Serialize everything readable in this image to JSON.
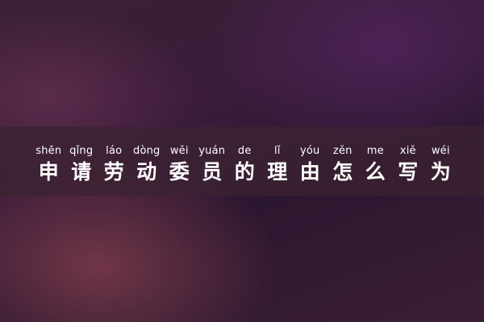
{
  "title": {
    "units": [
      {
        "pinyin": "shēn",
        "hanzi": "申"
      },
      {
        "pinyin": "qǐng",
        "hanzi": "请"
      },
      {
        "pinyin": "láo",
        "hanzi": "劳"
      },
      {
        "pinyin": "dòng",
        "hanzi": "动"
      },
      {
        "pinyin": "wěi",
        "hanzi": "委"
      },
      {
        "pinyin": "yuán",
        "hanzi": "员"
      },
      {
        "pinyin": "de",
        "hanzi": "的"
      },
      {
        "pinyin": "lǐ",
        "hanzi": "理"
      },
      {
        "pinyin": "yóu",
        "hanzi": "由"
      },
      {
        "pinyin": "zěn",
        "hanzi": "怎"
      },
      {
        "pinyin": "me",
        "hanzi": "么"
      },
      {
        "pinyin": "xiě",
        "hanzi": "写"
      },
      {
        "pinyin": "wéi",
        "hanzi": "为"
      }
    ]
  },
  "colors": {
    "text": "#ffffff",
    "band": "#3c2332"
  }
}
